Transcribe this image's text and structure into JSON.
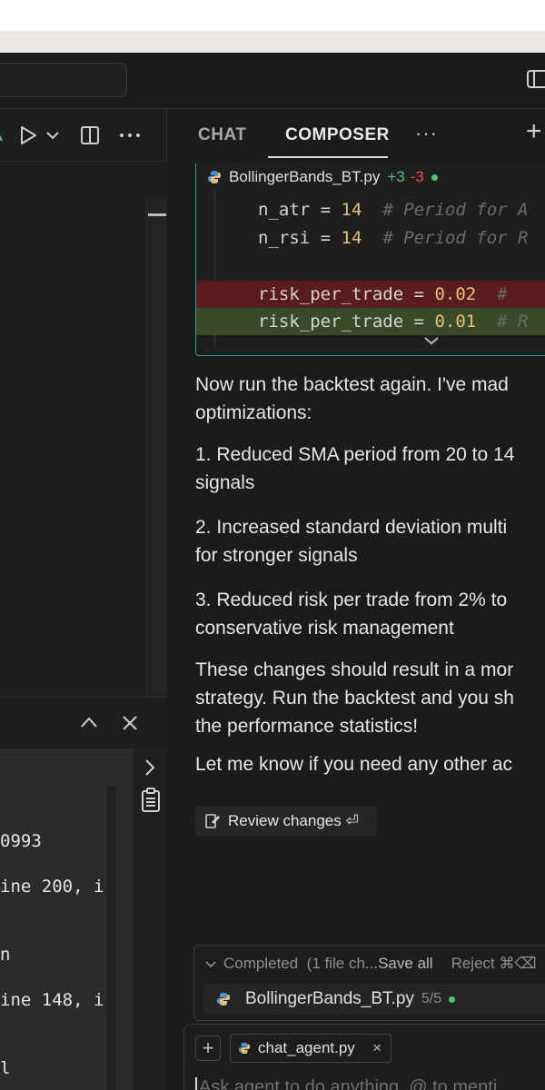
{
  "editor": {
    "toolbar_icons": [
      "branch-icon",
      "run-icon",
      "chevron-down-icon",
      "split-editor-icon",
      "more-icon"
    ],
    "panel_icons": [
      "chevron-up-icon",
      "close-icon"
    ],
    "terminal_lines": [
      "0993",
      "ine 200, i",
      "n",
      "ine 148, i",
      "l"
    ]
  },
  "chat": {
    "tabs": [
      {
        "label": "CHAT"
      },
      {
        "label": "COMPOSER"
      }
    ],
    "more": "···",
    "new": "+",
    "code_card": {
      "file_name": "BollingerBands_BT.py",
      "added": "+3",
      "removed": "-3",
      "lines": [
        {
          "name": "n_atr",
          "value": "14",
          "comment": "# Period for A"
        },
        {
          "name": "n_rsi",
          "value": "14",
          "comment": "# Period for R"
        },
        {
          "name": "risk_per_trade",
          "value": "0.02",
          "comment": "# "
        },
        {
          "name": "risk_per_trade",
          "value": "0.01",
          "comment": "# R"
        }
      ]
    },
    "messages": [
      "Now run the backtest again. I've mad",
      "optimizations:",
      "1. Reduced SMA period from 20 to 14",
      "signals",
      "2. Increased standard deviation multi",
      "for stronger signals",
      "3. Reduced risk per trade from 2% to",
      "conservative risk management",
      "These changes should result in a mor",
      "strategy. Run the backtest and you sh",
      "the performance statistics!",
      "Let me know if you need any other ac"
    ],
    "review_label": "Review changes ⏎",
    "completed": {
      "status": "Completed",
      "detail": "(1 file ch...",
      "save_all": "Save all",
      "reject": "Reject ⌘⌫",
      "file_name": "BollingerBands_BT.py",
      "file_count": "5/5"
    },
    "input": {
      "add": "+",
      "chip_label": "chat_agent.py",
      "chip_close": "×",
      "placeholder": "Ask agent to do anything, @ to menti"
    }
  }
}
